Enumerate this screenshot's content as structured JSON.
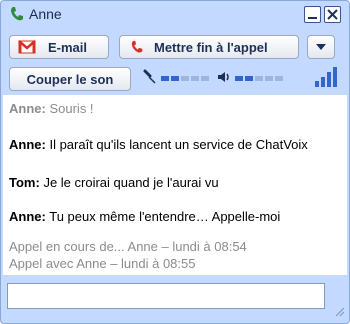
{
  "window": {
    "title": "Anne"
  },
  "toolbar": {
    "email_label": "E-mail",
    "end_call_label": "Mettre fin à l'appel",
    "mute_label": "Couper le son",
    "mic_level": 0.3,
    "speaker_level": 0.4
  },
  "messages": [
    {
      "sender": "Anne:",
      "text": "Souris !"
    },
    {
      "sender": "Anne:",
      "text": "Il paraît qu'ils lancent un service de ChatVoix"
    },
    {
      "sender": "Tom:",
      "text": "Je le croirai quand je l'aurai vu"
    },
    {
      "sender": "Anne:",
      "text": "Tu peux même l'entendre… Appelle-moi"
    }
  ],
  "status_lines": [
    "Appel en cours de... Anne – lundi à 08:54",
    "Appel avec Anne – lundi à 08:55"
  ],
  "input": {
    "value": ""
  },
  "colors": {
    "window_frame": "#c3d9ff",
    "gmail_red": "#d93025",
    "phone_green": "#2e8b3a",
    "text_dark": "#1f2f57",
    "meta_gray": "#8c8c8c",
    "level_blue": "#3366cc"
  },
  "icons": [
    "phone-icon",
    "minimize-icon",
    "close-icon",
    "gmail-icon",
    "end-call-icon",
    "chevron-down-icon",
    "microphone-icon",
    "speaker-icon",
    "signal-icon",
    "resize-grip-icon"
  ]
}
